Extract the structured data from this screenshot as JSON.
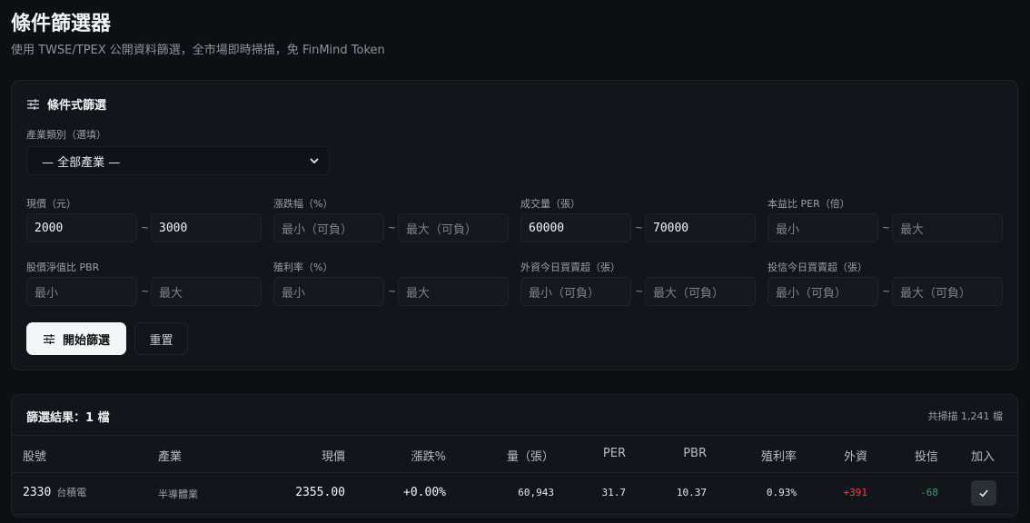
{
  "header": {
    "title": "條件篩選器",
    "subtitle": "使用 TWSE/TPEX 公開資料篩選，全市場即時掃描，免 FinMind Token"
  },
  "filter": {
    "title": "條件式篩選",
    "industry_label": "產業類別（選填）",
    "industry_value": "— 全部產業 —",
    "fields": {
      "price": {
        "label": "現價（元）",
        "min": "2000",
        "max": "3000"
      },
      "change": {
        "label": "漲跌幅（%）",
        "min_ph": "最小（可負）",
        "max_ph": "最大（可負）"
      },
      "volume": {
        "label": "成交量（張）",
        "min": "60000",
        "max": "70000"
      },
      "per": {
        "label": "本益比 PER（倍）",
        "min_ph": "最小",
        "max_ph": "最大"
      },
      "pbr": {
        "label": "股價淨值比 PBR",
        "min_ph": "最小",
        "max_ph": "最大"
      },
      "yield": {
        "label": "殖利率（%）",
        "min_ph": "最小",
        "max_ph": "最大"
      },
      "foreign": {
        "label": "外資今日買賣超（張）",
        "min_ph": "最小（可負）",
        "max_ph": "最大（可負）"
      },
      "trust": {
        "label": "投信今日買賣超（張）",
        "min_ph": "最小（可負）",
        "max_ph": "最大（可負）"
      }
    },
    "tilde": "~",
    "start_button": "開始篩選",
    "reset_button": "重置"
  },
  "results": {
    "title": "篩選結果：1 檔",
    "scanned": "共掃描 1,241 檔",
    "columns": [
      "股號",
      "產業",
      "現價",
      "漲跌%",
      "量（張）",
      "PER",
      "PBR",
      "殖利率",
      "外資",
      "投信",
      "加入"
    ],
    "rows": [
      {
        "code": "2330",
        "name": "台積電",
        "industry": "半導體業",
        "price": "2355.00",
        "change": "+0.00%",
        "volume": "60,943",
        "per": "31.7",
        "pbr": "10.37",
        "yield": "0.93%",
        "foreign": "+391",
        "trust": "-68"
      }
    ]
  },
  "colors": {
    "positive": "#e5484d",
    "negative": "#30a46c"
  }
}
